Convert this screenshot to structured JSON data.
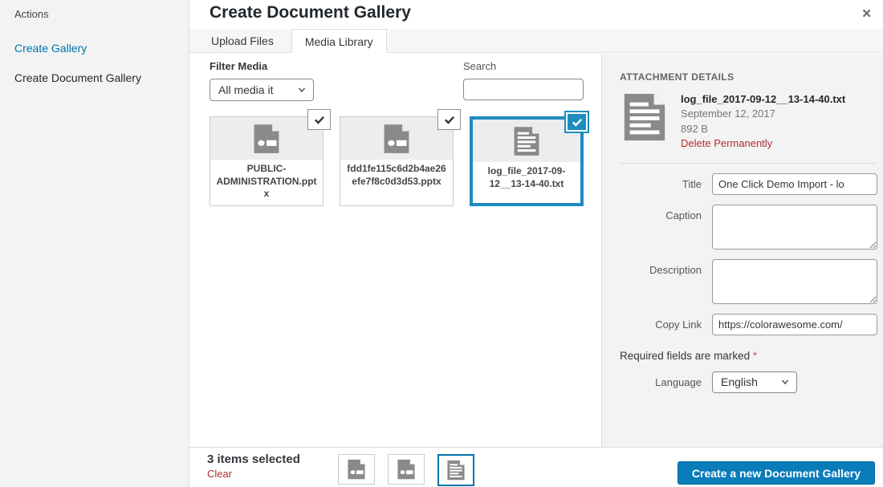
{
  "colors": {
    "accent_blue": "#0a7cba",
    "selection_blue": "#1e8cbe",
    "link_blue": "#0073aa",
    "danger_red": "#b32d2e",
    "panel_gray": "#f3f3f3"
  },
  "icons": {
    "close": "✕",
    "check": "✓",
    "chevron_down": "⌄",
    "presentation_file": "presentation-file-icon",
    "text_file": "text-file-icon"
  },
  "window": {
    "title": "Create Document Gallery"
  },
  "sidebar": {
    "heading": "Actions",
    "items": [
      {
        "label": "Create Gallery",
        "active": false
      },
      {
        "label": "Create Document Gallery",
        "active": true
      }
    ]
  },
  "tabs": [
    {
      "label": "Upload Files",
      "active": false
    },
    {
      "label": "Media Library",
      "active": true
    }
  ],
  "library": {
    "filter": {
      "label": "Filter Media",
      "value": "All media it"
    },
    "search": {
      "label": "Search",
      "value": ""
    }
  },
  "media_items": [
    {
      "filename": "PUBLIC-ADMINISTRATION.pptx",
      "type": "pptx",
      "selected": true,
      "focused": false
    },
    {
      "filename": "fdd1fe115c6d2b4ae26efe7f8c0d3d53.pptx",
      "type": "pptx",
      "selected": true,
      "focused": false
    },
    {
      "filename": "log_file_2017-09-12__13-14-40.txt",
      "type": "txt",
      "selected": true,
      "focused": true
    }
  ],
  "details": {
    "heading": "ATTACHMENT DETAILS",
    "filename": "log_file_2017-09-12__13-14-40.txt",
    "date": "September 12, 2017",
    "filesize": "892 B",
    "delete_label": "Delete Permanently",
    "fields": {
      "title": {
        "label": "Title",
        "value": "One Click Demo Import - lo"
      },
      "caption": {
        "label": "Caption",
        "value": ""
      },
      "description": {
        "label": "Description",
        "value": ""
      },
      "copy_link": {
        "label": "Copy Link",
        "value": "https://colorawesome.com/"
      }
    },
    "required_note": "Required fields are marked",
    "required_star": "*",
    "language": {
      "label": "Language",
      "value": "English"
    }
  },
  "toolbar": {
    "selection_count": "3 items selected",
    "clear_label": "Clear",
    "primary_button": "Create a new Document Gallery"
  }
}
